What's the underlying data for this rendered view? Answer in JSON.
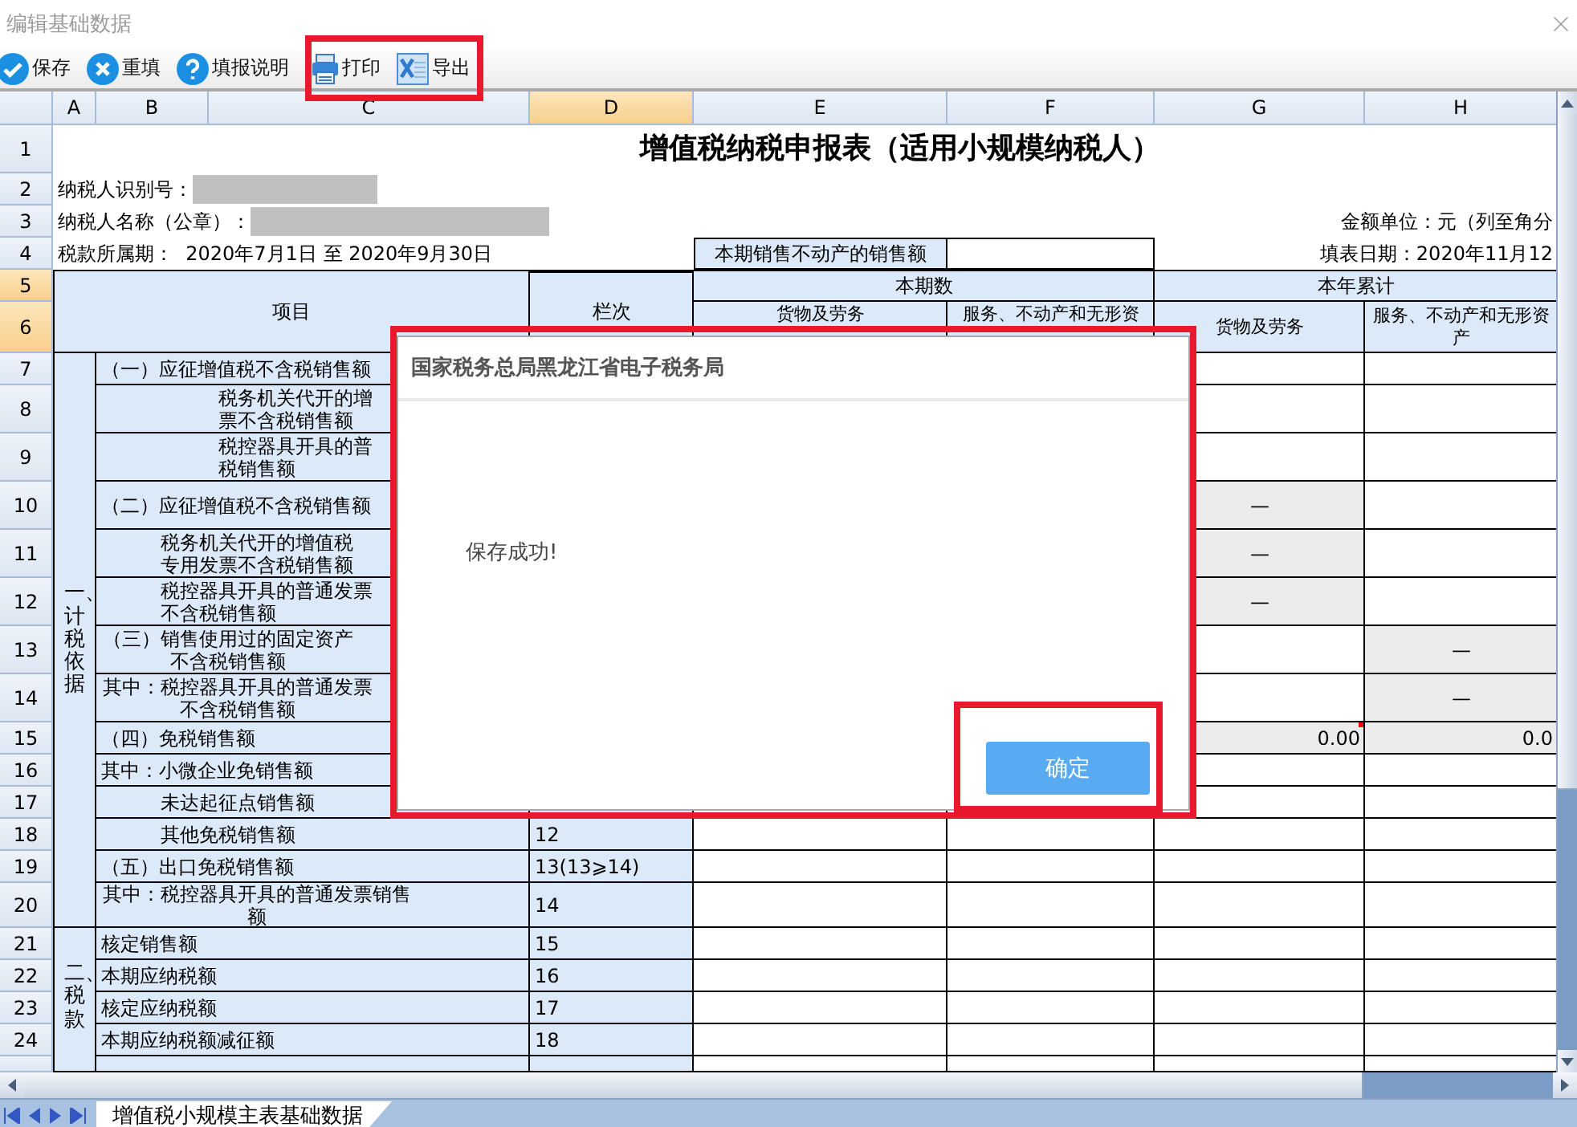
{
  "window": {
    "title": "编辑基础数据"
  },
  "toolbar": [
    {
      "items": [
        {
          "kind": "save",
          "label": "保存"
        },
        {
          "kind": "reset",
          "label": "重填"
        },
        {
          "kind": "help",
          "label": "填报说明"
        }
      ]
    },
    {
      "highlighted": true,
      "items": [
        {
          "kind": "print",
          "label": "打印"
        },
        {
          "kind": "export",
          "label": "导出"
        }
      ]
    }
  ],
  "sheet": {
    "columns": [
      {
        "label": "A",
        "selected": false
      },
      {
        "label": "B",
        "selected": false
      },
      {
        "label": "C",
        "selected": false
      },
      {
        "label": "D",
        "selected": true
      },
      {
        "label": "E",
        "selected": false
      },
      {
        "label": "F",
        "selected": false
      },
      {
        "label": "G",
        "selected": false
      },
      {
        "label": "H",
        "selected": false
      }
    ],
    "row_numbers": [
      {
        "label": "1",
        "selected": false
      },
      {
        "label": "2",
        "selected": false
      },
      {
        "label": "3",
        "selected": false
      },
      {
        "label": "4",
        "selected": false
      },
      {
        "label": "5",
        "selected": true
      },
      {
        "label": "6",
        "selected": true
      },
      {
        "label": "7",
        "selected": false
      },
      {
        "label": "8",
        "selected": false
      },
      {
        "label": "9",
        "selected": false
      },
      {
        "label": "10",
        "selected": false
      },
      {
        "label": "11",
        "selected": false
      },
      {
        "label": "12",
        "selected": false
      },
      {
        "label": "13",
        "selected": false
      },
      {
        "label": "14",
        "selected": false
      },
      {
        "label": "15",
        "selected": false
      },
      {
        "label": "16",
        "selected": false
      },
      {
        "label": "17",
        "selected": false
      },
      {
        "label": "18",
        "selected": false
      },
      {
        "label": "19",
        "selected": false
      },
      {
        "label": "20",
        "selected": false
      },
      {
        "label": "21",
        "selected": false
      },
      {
        "label": "22",
        "selected": false
      },
      {
        "label": "23",
        "selected": false
      },
      {
        "label": "24",
        "selected": false
      }
    ],
    "title": "增值税纳税申报表（适用小规模纳税人）",
    "taxpayer_id": {
      "label": "纳税人识别号：",
      "redacted": true
    },
    "taxpayer_name": {
      "label": "纳税人名称（公章）：",
      "redacted": true
    },
    "amount_unit": "金额单位：元（列至角分",
    "period": "税款所属期：  2020年7月1日 至 2020年9月30日",
    "property_sales_label": "本期销售不动产的销售额",
    "fill_date": "填表日期：2020年11月12",
    "headers": {
      "item": "项目",
      "line": "栏次",
      "current_period": "本期数",
      "year_total": "本年累计",
      "current_columns": [
        {
          "lines": [
            "货物及劳务"
          ]
        },
        {
          "lines": [
            "服务、不动产和无形资"
          ]
        }
      ],
      "year_columns": [
        {
          "lines": [
            "货物及劳务"
          ]
        },
        {
          "lines": [
            "服务、不动产和无形资",
            "产"
          ]
        }
      ]
    },
    "sections": [
      {
        "label": "一、计税依据",
        "rows": [
          {
            "kind": "main",
            "lines": [
              "（一）应征增值税不含税销售额"
            ],
            "amounts": [
              {
                "shaded": false
              },
              {
                "shaded": false
              }
            ]
          },
          {
            "kind": "deep",
            "lines": [
              "税务机关代开的增",
              "票不含税销售额"
            ],
            "amounts": [
              {
                "shaded": false
              },
              {
                "shaded": false
              }
            ]
          },
          {
            "kind": "deep",
            "lines": [
              "税控器具开具的普",
              "税销售额"
            ],
            "amounts": [
              {
                "shaded": false
              },
              {
                "shaded": false
              }
            ]
          },
          {
            "kind": "main",
            "lines": [
              "（二）应征增值税不含税销售额"
            ],
            "amounts": [
              {
                "shaded": true,
                "text": "—"
              },
              {
                "shaded": false
              }
            ]
          },
          {
            "kind": "sub",
            "lines": [
              "税务机关代开的增值税",
              "专用发票不含税销售额"
            ],
            "amounts": [
              {
                "shaded": true,
                "text": "—"
              },
              {
                "shaded": false
              }
            ]
          },
          {
            "kind": "sub",
            "lines": [
              "税控器具开具的普通发票",
              "不含税销售额"
            ],
            "amounts": [
              {
                "shaded": true,
                "text": "—"
              },
              {
                "shaded": false
              }
            ]
          },
          {
            "kind": "wrapped",
            "lines": [
              "（三）销售使用过的固定资产",
              "不含税销售额"
            ],
            "amounts": [
              {
                "shaded": false
              },
              {
                "shaded": true,
                "text": "—"
              }
            ]
          },
          {
            "kind": "wrapped",
            "lines": [
              "其中：税控器具开具的普通发票",
              "不含税销售额"
            ],
            "amounts": [
              {
                "shaded": false
              },
              {
                "shaded": true,
                "text": "—"
              }
            ]
          },
          {
            "kind": "main",
            "lines": [
              "（四）免税销售额"
            ],
            "amounts": [
              {
                "shaded": true,
                "text": "0.00",
                "flag": true
              },
              {
                "shaded": true,
                "text": "0.0"
              }
            ]
          },
          {
            "kind": "main",
            "lines": [
              "其中：小微企业免销售额"
            ],
            "amounts": [
              {
                "shaded": false
              },
              {
                "shaded": false
              }
            ]
          },
          {
            "kind": "sub",
            "lines": [
              "未达起征点销售额"
            ],
            "amounts": [
              {
                "shaded": false
              },
              {
                "shaded": false
              }
            ]
          },
          {
            "kind": "sub",
            "lines": [
              "其他免税销售额"
            ],
            "line": "12",
            "amounts": [
              {
                "shaded": false
              },
              {
                "shaded": false
              },
              {
                "shaded": false
              },
              {
                "shaded": false
              }
            ]
          },
          {
            "kind": "main",
            "lines": [
              "（五）出口免税销售额"
            ],
            "line": "13(13⩾14)",
            "amounts": [
              {
                "shaded": false
              },
              {
                "shaded": false
              },
              {
                "shaded": false
              },
              {
                "shaded": false
              }
            ]
          },
          {
            "kind": "wrapped",
            "lines": [
              "其中：税控器具开具的普通发票销售",
              "额"
            ],
            "line": "14",
            "amounts": [
              {
                "shaded": false
              },
              {
                "shaded": false
              },
              {
                "shaded": false
              },
              {
                "shaded": false
              }
            ]
          }
        ]
      },
      {
        "label": "二、税款",
        "rows": [
          {
            "kind": "main",
            "lines": [
              "核定销售额"
            ],
            "line": "15",
            "amounts": [
              {
                "shaded": false
              },
              {
                "shaded": false
              },
              {
                "shaded": false
              },
              {
                "shaded": false
              }
            ]
          },
          {
            "kind": "main",
            "lines": [
              "本期应纳税额"
            ],
            "line": "16",
            "amounts": [
              {
                "shaded": false
              },
              {
                "shaded": false
              },
              {
                "shaded": false
              },
              {
                "shaded": false
              }
            ]
          },
          {
            "kind": "main",
            "lines": [
              "核定应纳税额"
            ],
            "line": "17",
            "amounts": [
              {
                "shaded": false
              },
              {
                "shaded": false
              },
              {
                "shaded": false
              },
              {
                "shaded": false
              }
            ]
          },
          {
            "kind": "main",
            "lines": [
              "本期应纳税额减征额"
            ],
            "line": "18",
            "amounts": [
              {
                "shaded": false
              },
              {
                "shaded": false
              },
              {
                "shaded": false
              },
              {
                "shaded": false
              }
            ]
          }
        ]
      }
    ]
  },
  "sheet_tabs": [
    {
      "label": "增值税小规模主表基础数据",
      "selected": true
    }
  ],
  "dialog": {
    "title": "国家税务总局黑龙江省电子税务局",
    "message": "保存成功!",
    "button": "确定",
    "highlighted": true,
    "button_highlighted": true
  }
}
